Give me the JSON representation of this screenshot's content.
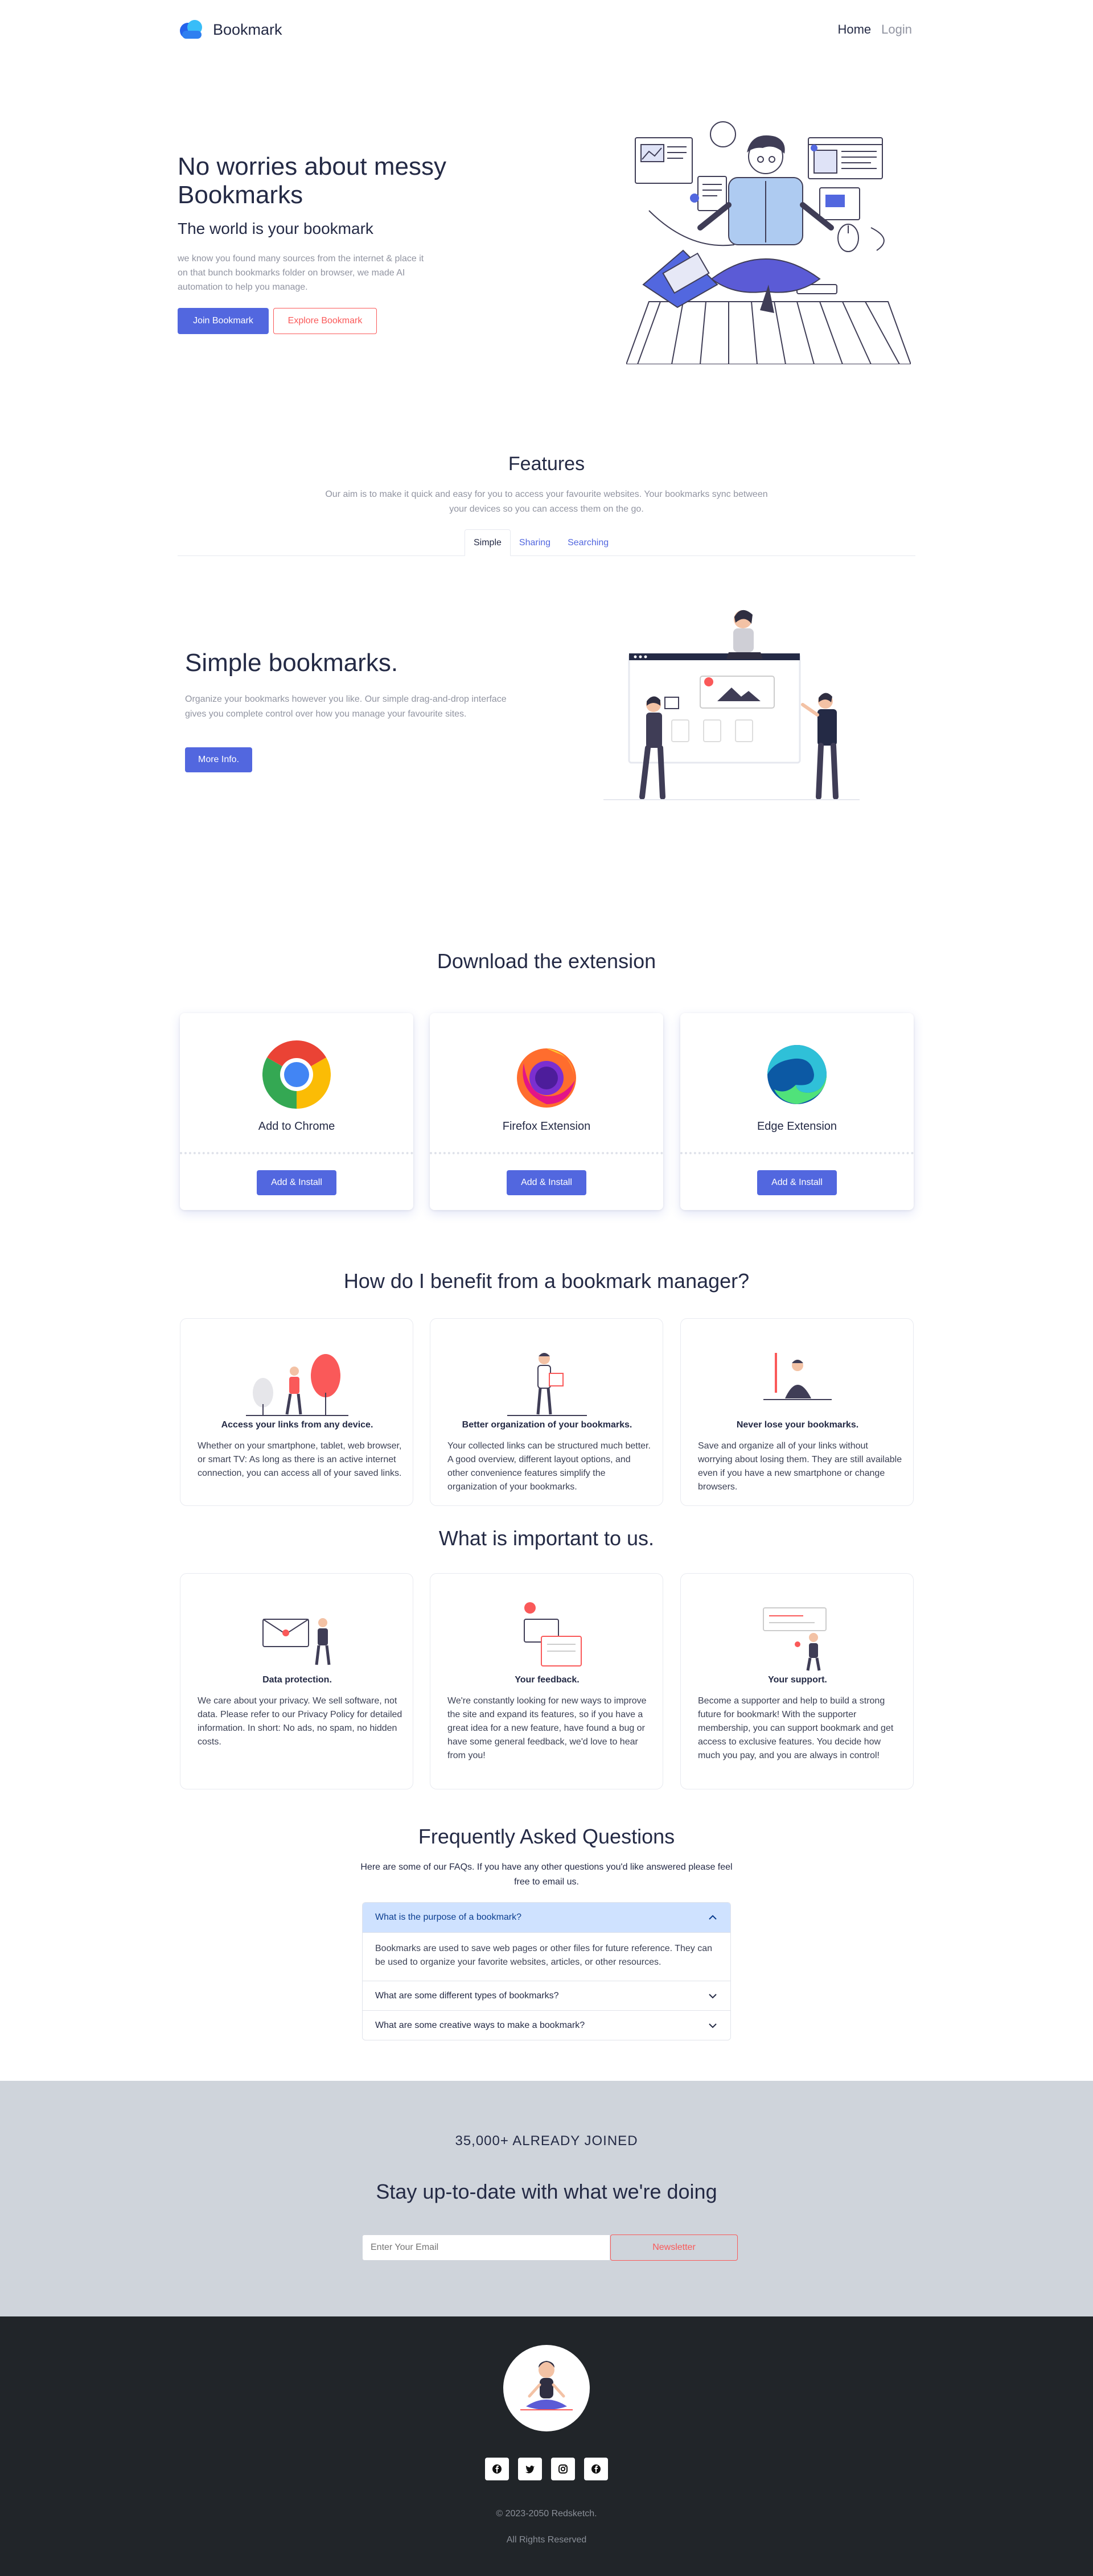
{
  "nav": {
    "brand": "Bookmark",
    "links": [
      "Home",
      "Login"
    ]
  },
  "hero": {
    "title": "No worries about messy Bookmarks",
    "subtitle": "The world is your bookmark",
    "description": "we know you found many sources from the internet & place it on that bunch bookmarks folder on browser, we made AI automation to help you manage.",
    "join_label": "Join Bookmark",
    "explore_label": "Explore Bookmark"
  },
  "features": {
    "title": "Features",
    "description": "Our aim is to make it quick and easy for you to access your favourite websites. Your bookmarks sync between your devices so you can access them on the go.",
    "tabs": [
      "Simple",
      "Sharing",
      "Searching"
    ],
    "active_tab": "Simple",
    "panel": {
      "title": "Simple bookmarks.",
      "description": "Organize your bookmarks however you like. Our simple drag-and-drop interface gives you complete control over how you manage your favourite sites.",
      "button": "More Info."
    }
  },
  "download": {
    "title": "Download the extension",
    "cards": [
      {
        "name": "Add to Chrome",
        "button": "Add & Install",
        "icon": "chrome-icon"
      },
      {
        "name": "Firefox Extension",
        "button": "Add & Install",
        "icon": "firefox-icon"
      },
      {
        "name": "Edge Extension",
        "button": "Add & Install",
        "icon": "edge-icon"
      }
    ]
  },
  "benefits": {
    "title": "How do I benefit from a bookmark manager?",
    "items": [
      {
        "title": "Access your links from any device.",
        "text": "Whether on your smartphone, tablet, web browser, or smart TV: As long as there is an active internet connection, you can access all of your saved links."
      },
      {
        "title": "Better organization of your bookmarks.",
        "text": "Your collected links can be structured much better. A good overview, different layout options, and other convenience features simplify the organization of your bookmarks."
      },
      {
        "title": "Never lose your bookmarks.",
        "text": "Save and organize all of your links without worrying about losing them. They are still available even if you have a new smartphone or change browsers."
      }
    ]
  },
  "important": {
    "title": "What is important to us.",
    "items": [
      {
        "title": "Data protection.",
        "text": "We care about your privacy. We sell software, not data. Please refer to our Privacy Policy for detailed information. In short: No ads, no spam, no hidden costs."
      },
      {
        "title": "Your feedback.",
        "text": "We're constantly looking for new ways to improve the site and expand its features, so if you have a great idea for a new feature, have found a bug or have some general feedback, we'd love to hear from you!"
      },
      {
        "title": "Your support.",
        "text": "Become a supporter and help to build a strong future for bookmark! With the supporter membership, you can support bookmark and get access to exclusive features. You decide how much you pay, and you are always in control!"
      }
    ]
  },
  "faq": {
    "title": "Frequently Asked Questions",
    "description": "Here are some of our FAQs. If you have any other questions you'd like answered please feel free to email us.",
    "items": [
      {
        "question": "What is the purpose of a bookmark?",
        "answer": "Bookmarks are used to save web pages or other files for future reference. They can be used to organize your favorite websites, articles, or other resources."
      },
      {
        "question": "What are some different types of bookmarks?"
      },
      {
        "question": "What are some creative ways to make a bookmark?"
      }
    ]
  },
  "newsletter": {
    "count": "35,000+ ALREADY JOINED",
    "title": "Stay up-to-date with what we're doing",
    "placeholder": "Enter Your Email",
    "button": "Newsletter"
  },
  "footer": {
    "copyright": "© 2023-2050 Redsketch.",
    "rights": "All Rights Reserved",
    "socials": [
      "facebook-icon",
      "twitter-icon",
      "instagram-icon",
      "facebook-icon"
    ]
  },
  "colors": {
    "primary": "#5267df",
    "accent_red": "#fa5959",
    "dark": "#242a45",
    "grey": "#9194a1",
    "footer_bg": "#212529",
    "newsletter_bg": "#cfd4db",
    "faq_open_bg": "#cfe2ff"
  }
}
